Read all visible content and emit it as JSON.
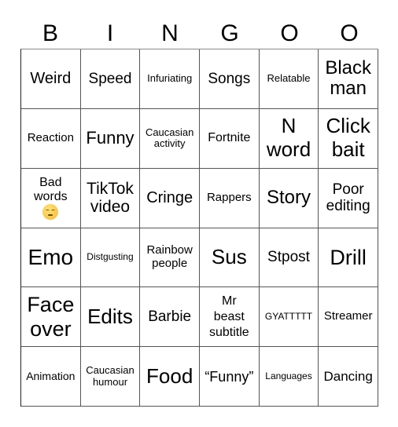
{
  "header": [
    "B",
    "I",
    "N",
    "G",
    "O",
    "O"
  ],
  "cells": [
    [
      "Weird",
      "Speed",
      "Infuriating",
      "Songs",
      "Relatable",
      "Black man"
    ],
    [
      "Reaction",
      "Funny",
      "Caucasian activity",
      "Fortnite",
      "N word",
      "Click bait"
    ],
    [
      "Bad words",
      "TikTok video",
      "Cringe",
      "Rappers",
      "Story",
      "Poor editing"
    ],
    [
      "Emo",
      "Distgusting",
      "Rainbow people",
      "Sus",
      "Stpost",
      "Drill"
    ],
    [
      "Face over",
      "Edits",
      "Barbie",
      "Mr beast subtitle",
      "GYATTTTT",
      "Streamer"
    ],
    [
      "Animation",
      "Caucasian humour",
      "Food",
      "“Funny”",
      "Languages",
      "Dancing"
    ]
  ],
  "emoji": {
    "cell": "Bad words",
    "icon": "pensive-face-emoji"
  }
}
